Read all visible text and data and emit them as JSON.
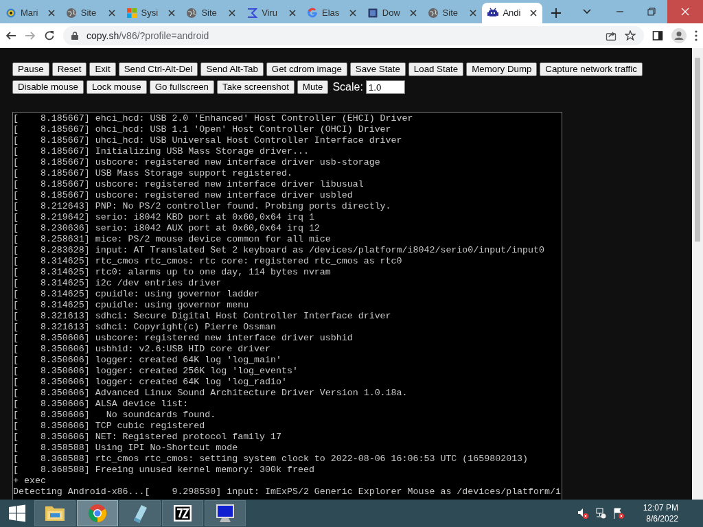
{
  "tabs": [
    {
      "title": "Mari",
      "selected": false
    },
    {
      "title": "Site",
      "selected": false
    },
    {
      "title": "Sysi",
      "selected": false
    },
    {
      "title": "Site",
      "selected": false
    },
    {
      "title": "Viru",
      "selected": false
    },
    {
      "title": "Elas",
      "selected": false
    },
    {
      "title": "Dow",
      "selected": false
    },
    {
      "title": "Site",
      "selected": false
    },
    {
      "title": "Andi",
      "selected": true
    }
  ],
  "address": {
    "host": "copy.sh",
    "path": "/v86/?profile=android"
  },
  "buttons_row1": [
    "Pause",
    "Reset",
    "Exit",
    "Send Ctrl-Alt-Del",
    "Send Alt-Tab",
    "Get cdrom image",
    "Save State",
    "Load State",
    "Memory Dump",
    "Capture network traffic"
  ],
  "buttons_row2": [
    "Disable mouse",
    "Lock mouse",
    "Go fullscreen",
    "Take screenshot",
    "Mute"
  ],
  "scale": {
    "label": "Scale:",
    "value": "1.0"
  },
  "terminal_lines": [
    "[    8.185667] ehci_hcd: USB 2.0 'Enhanced' Host Controller (EHCI) Driver",
    "[    8.185667] ohci_hcd: USB 1.1 'Open' Host Controller (OHCI) Driver",
    "[    8.185667] uhci_hcd: USB Universal Host Controller Interface driver",
    "[    8.185667] Initializing USB Mass Storage driver...",
    "[    8.185667] usbcore: registered new interface driver usb-storage",
    "[    8.185667] USB Mass Storage support registered.",
    "[    8.185667] usbcore: registered new interface driver libusual",
    "[    8.185667] usbcore: registered new interface driver usbled",
    "[    8.212643] PNP: No PS/2 controller found. Probing ports directly.",
    "[    8.219642] serio: i8042 KBD port at 0x60,0x64 irq 1",
    "[    8.230636] serio: i8042 AUX port at 0x60,0x64 irq 12",
    "[    8.258631] mice: PS/2 mouse device common for all mice",
    "[    8.283628] input: AT Translated Set 2 keyboard as /devices/platform/i8042/serio0/input/input0",
    "[    8.314625] rtc_cmos rtc_cmos: rtc core: registered rtc_cmos as rtc0",
    "[    8.314625] rtc0: alarms up to one day, 114 bytes nvram",
    "[    8.314625] i2c /dev entries driver",
    "[    8.314625] cpuidle: using governor ladder",
    "[    8.314625] cpuidle: using governor menu",
    "[    8.321613] sdhci: Secure Digital Host Controller Interface driver",
    "[    8.321613] sdhci: Copyright(c) Pierre Ossman",
    "[    8.350606] usbcore: registered new interface driver usbhid",
    "[    8.350606] usbhid: v2.6:USB HID core driver",
    "[    8.350606] logger: created 64K log 'log_main'",
    "[    8.350606] logger: created 256K log 'log_events'",
    "[    8.350606] logger: created 64K log 'log_radio'",
    "[    8.350606] Advanced Linux Sound Architecture Driver Version 1.0.18a.",
    "[    8.350606] ALSA device list:",
    "[    8.350606]   No soundcards found.",
    "[    8.350606] TCP cubic registered",
    "[    8.350606] NET: Registered protocol family 17",
    "[    8.358588] Using IPI No-Shortcut mode",
    "[    8.368588] rtc_cmos rtc_cmos: setting system clock to 2022-08-06 16:06:53 UTC (1659802013)",
    "[    8.368588] Freeing unused kernel memory: 300k freed",
    "+ exec",
    "Detecting Android-x86...[    9.298530] input: ImExPS/2 Generic Explorer Mouse as /devices/platform/i"
  ],
  "taskbar_apps": [
    {
      "selected": false
    },
    {
      "selected": true
    },
    {
      "selected": false
    },
    {
      "selected": false
    },
    {
      "selected": false
    }
  ],
  "clock": {
    "time": "12:07 PM",
    "date": "8/6/2022"
  }
}
